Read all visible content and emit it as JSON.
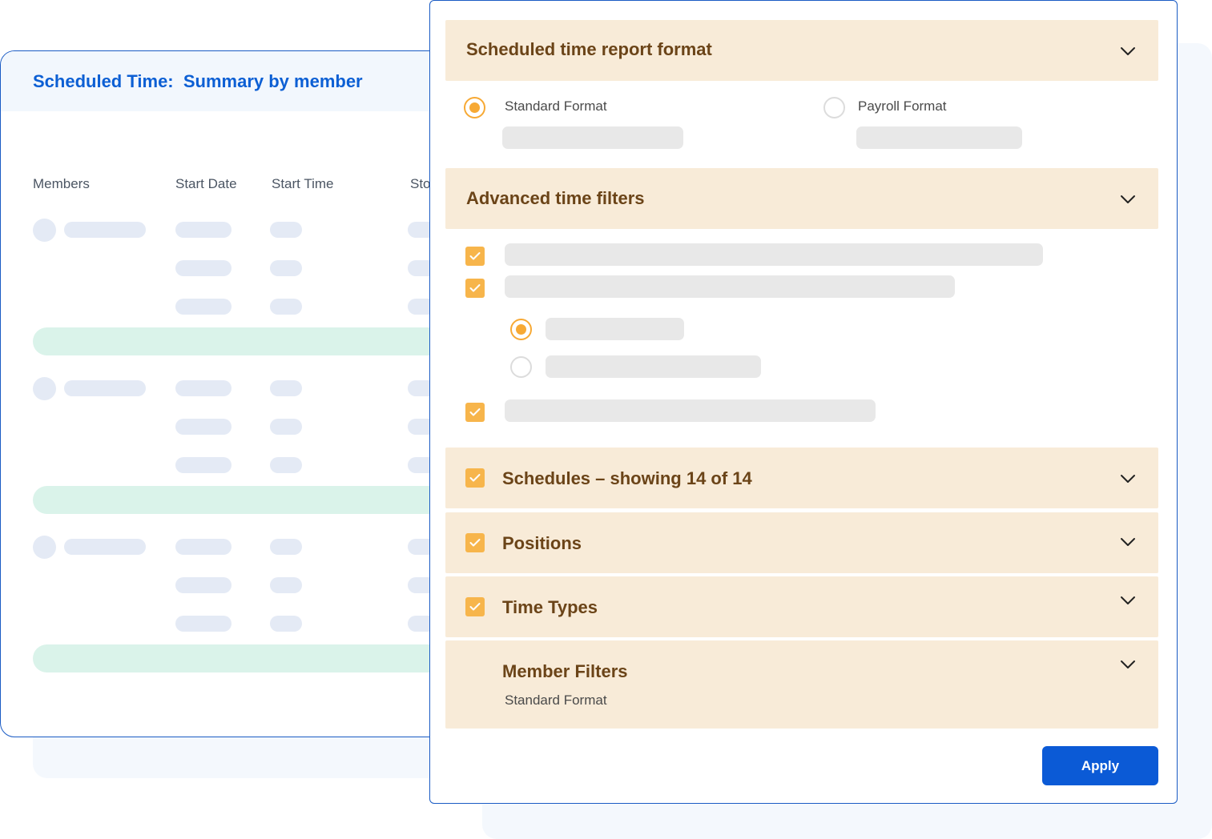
{
  "report": {
    "title_prefix": "Scheduled Time:  ",
    "title_main": "Summary by member",
    "columns": [
      "Members",
      "Start Date",
      "Start Time",
      "Sto"
    ]
  },
  "filters": {
    "report_format": {
      "title": "Scheduled time report format",
      "options": [
        {
          "label": "Standard Format",
          "selected": true
        },
        {
          "label": "Payroll Format",
          "selected": false
        }
      ]
    },
    "advanced": {
      "title": "Advanced time filters"
    },
    "schedules": {
      "title": "Schedules – showing 14 of 14",
      "checked": true
    },
    "positions": {
      "title": "Positions",
      "checked": true
    },
    "time_types": {
      "title": "Time Types",
      "checked": true
    },
    "member_filters": {
      "title": "Member Filters",
      "subtitle": "Standard Format"
    },
    "apply_label": "Apply"
  },
  "colors": {
    "accent_blue": "#0b5ad6",
    "accent_orange": "#f7b54b",
    "section_bg": "#f8ebd8",
    "section_text": "#6b4418"
  },
  "icons": [
    "chevron-down-icon",
    "check-icon"
  ]
}
